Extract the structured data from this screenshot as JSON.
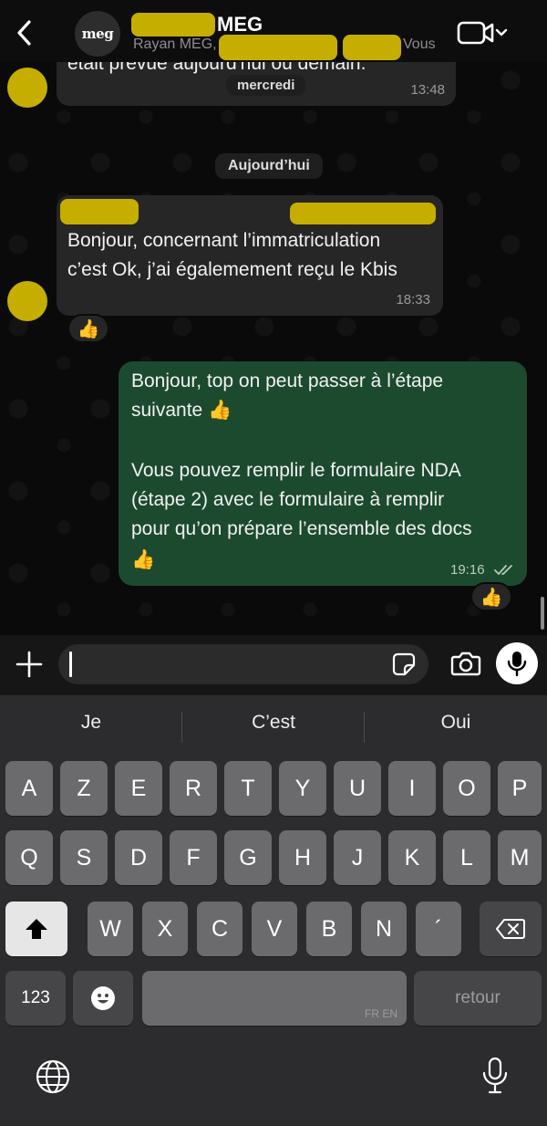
{
  "header": {
    "back_icon": "chevron-left-icon",
    "group_avatar_text": "meg",
    "title": "MEG",
    "members_prefix": "Rayan MEG,",
    "members_suffix": "Vous",
    "video_icon": "video-camera-icon"
  },
  "chat": {
    "partial_message": {
      "text": "était prévue aujourd'hui ou demain.",
      "day_label": "mercredi",
      "time": "13:48"
    },
    "date_divider": "Aujourd’hui",
    "incoming_message": {
      "line1": "Bonjour, concernant l’immatriculation",
      "line2": "c’est Ok, j’ai égalemement reçu le Kbis",
      "time": "18:33",
      "reaction": "👍"
    },
    "outgoing_message": {
      "line1": "Bonjour, top on peut passer à l’étape",
      "line2": "suivante 👍",
      "line3": "Vous pouvez remplir le formulaire NDA",
      "line4": "(étape 2) avec le formulaire à remplir",
      "line5": "pour qu’on prépare l’ensemble des docs",
      "line6": "👍",
      "time": "19:16",
      "status": "read",
      "reaction": "👍"
    }
  },
  "input_bar": {
    "placeholder": "",
    "icons": [
      "plus-icon",
      "sticker-icon",
      "camera-icon",
      "microphone-icon"
    ]
  },
  "keyboard": {
    "suggestions": [
      "Je",
      "C’est",
      "Oui"
    ],
    "row1": [
      "A",
      "Z",
      "E",
      "R",
      "T",
      "Y",
      "U",
      "I",
      "O",
      "P"
    ],
    "row2": [
      "Q",
      "S",
      "D",
      "F",
      "G",
      "H",
      "J",
      "K",
      "L",
      "M"
    ],
    "row3": [
      "W",
      "X",
      "C",
      "V",
      "B",
      "N",
      "´"
    ],
    "numbers_key": "123",
    "emoji_key": "☻",
    "space_lang": "FR EN",
    "return_key": "retour"
  },
  "colors": {
    "redaction": "#c5ae00",
    "outgoing_bubble": "#1c4a2f",
    "incoming_bubble": "#262626"
  }
}
